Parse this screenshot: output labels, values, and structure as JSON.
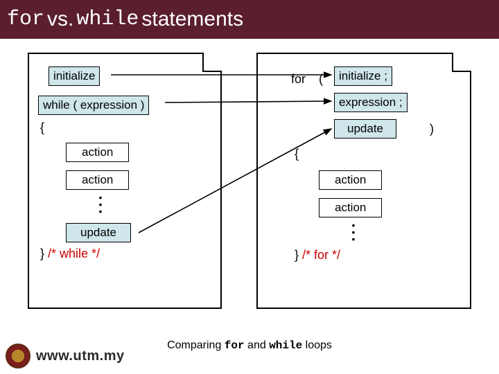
{
  "title": {
    "for": "for",
    "vs": "vs.",
    "while": "while",
    "stmts": " statements"
  },
  "left": {
    "init": "initialize",
    "while": "while ( expression )",
    "lbrace": "{",
    "a1": "action",
    "a2": "action",
    "update": "update",
    "rbrace": "}",
    "cmt": "/* while */"
  },
  "right": {
    "for": "for",
    "lpar": "(",
    "rpar": ")",
    "init": "initialize ;",
    "expr": "expression ;",
    "update": "update",
    "lbrace": "{",
    "a1": "action",
    "a2": "action",
    "rbrace": "}",
    "cmt": "/* for */"
  },
  "caption": {
    "a": "Comparing ",
    "b": "for",
    "c": " and ",
    "d": "while",
    "e": " loops"
  },
  "footer": {
    "site": "www.utm.my"
  }
}
